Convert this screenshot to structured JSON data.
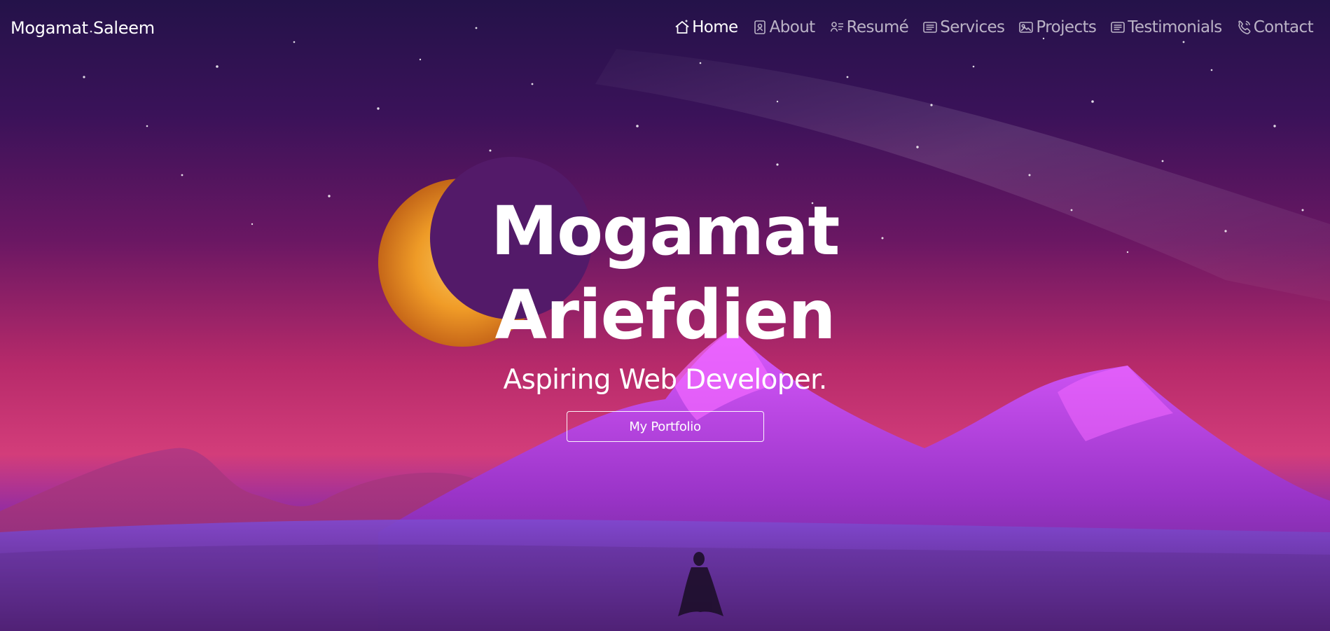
{
  "nav": {
    "brand": "Mogamat Saleem",
    "items": [
      {
        "label": "Home",
        "icon": "home-icon"
      },
      {
        "label": "About",
        "icon": "person-badge-icon"
      },
      {
        "label": "Resumé",
        "icon": "person-lines-icon"
      },
      {
        "label": "Services",
        "icon": "card-text-icon"
      },
      {
        "label": "Projects",
        "icon": "image-icon"
      },
      {
        "label": "Testimonials",
        "icon": "card-text-icon"
      },
      {
        "label": "Contact",
        "icon": "telephone-icon"
      }
    ],
    "active_item": "Home"
  },
  "hero": {
    "name": "Mogamat Ariefdien",
    "subtitle": "Aspiring Web Developer.",
    "button_label": "My Portfolio"
  },
  "colors": {
    "nav_text": "#ffffff",
    "nav_text_muted": "rgba(255,255,255,0.68)",
    "hero_text": "#ffffff",
    "sky_top": "#241249",
    "sky_mid": "#6a1763",
    "horizon_pink": "#d33d7a",
    "mountain_purple": "#8d2ba6",
    "moon_orange": "#f4a423"
  }
}
